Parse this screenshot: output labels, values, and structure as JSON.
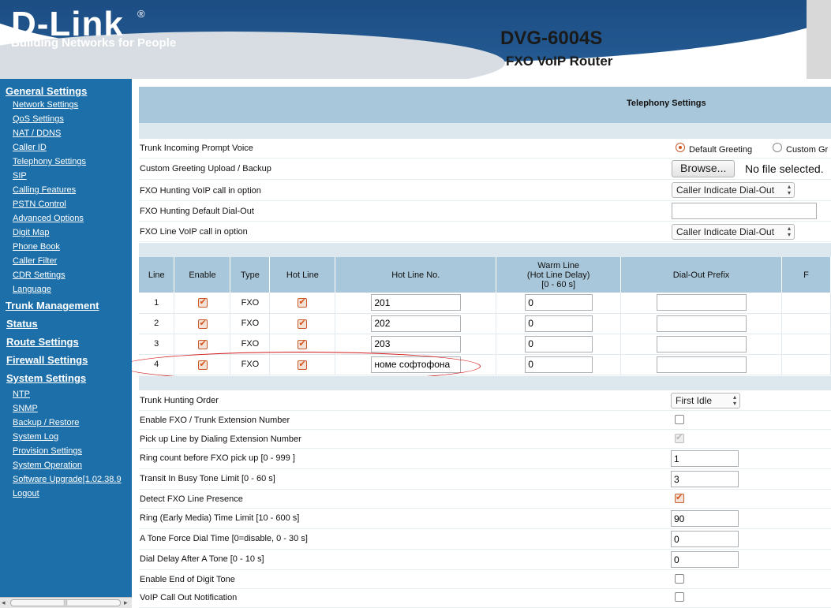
{
  "header": {
    "logo_text": "D-Link",
    "logo_reg": "®",
    "logo_tagline": "Building Networks for People",
    "model": "DVG-6004S",
    "model_sub": "FXO VoIP Router"
  },
  "sidebar": {
    "general": {
      "title": "General Settings",
      "items": [
        "Network Settings",
        "QoS Settings",
        "NAT / DDNS",
        "Caller ID",
        "Telephony Settings",
        "SIP",
        "Calling Features",
        "PSTN Control",
        "Advanced Options",
        "Digit Map",
        "Phone Book",
        "Caller Filter",
        "CDR Settings",
        "Language"
      ]
    },
    "trunk_management": "Trunk Management",
    "status": "Status",
    "route_settings": "Route Settings",
    "firewall_settings": "Firewall Settings",
    "system": {
      "title": "System Settings",
      "items": [
        "NTP",
        "SNMP",
        "Backup / Restore",
        "System Log",
        "Provision Settings",
        "System Operation",
        "Software Upgrade[1.02.38.9",
        "Logout"
      ]
    }
  },
  "page": {
    "title": "Telephony Settings"
  },
  "top_settings": {
    "prompt_voice_label": "Trunk Incoming Prompt Voice",
    "prompt_default": "Default Greeting",
    "prompt_custom": "Custom Gr",
    "greeting_label": "Custom Greeting Upload / Backup",
    "browse_label": "Browse...",
    "no_file": "No file selected.",
    "hunting_label": "FXO Hunting VoIP call in option",
    "hunting_value": "Caller Indicate Dial-Out",
    "hunting_default_label": "FXO Hunting Default Dial-Out",
    "hunting_default_value": "",
    "line_voip_label": "FXO Line VoIP call in option",
    "line_voip_value": "Caller Indicate Dial-Out"
  },
  "line_table": {
    "headers": {
      "line": "Line",
      "enable": "Enable",
      "type": "Type",
      "hot_line": "Hot Line",
      "hot_line_no": "Hot Line No.",
      "warm_line_1": "Warm Line",
      "warm_line_2": "(Hot Line Delay)",
      "warm_line_3": "[0 - 60 s]",
      "dial_out_prefix": "Dial-Out Prefix",
      "next": "F"
    },
    "rows": [
      {
        "line": "1",
        "type": "FXO",
        "enable": true,
        "hot_line": true,
        "hot_line_no": "201",
        "warm_line": "0",
        "prefix": ""
      },
      {
        "line": "2",
        "type": "FXO",
        "enable": true,
        "hot_line": true,
        "hot_line_no": "202",
        "warm_line": "0",
        "prefix": ""
      },
      {
        "line": "3",
        "type": "FXO",
        "enable": true,
        "hot_line": true,
        "hot_line_no": "203",
        "warm_line": "0",
        "prefix": ""
      },
      {
        "line": "4",
        "type": "FXO",
        "enable": true,
        "hot_line": true,
        "hot_line_no": "номе софтофона",
        "warm_line": "0",
        "prefix": ""
      }
    ]
  },
  "bottom_settings": {
    "trunk_hunting_label": "Trunk Hunting Order",
    "trunk_hunting_value": "First Idle",
    "enable_fxo_ext_label": "Enable FXO / Trunk Extension Number",
    "pickup_label": "Pick up Line by Dialing Extension Number",
    "ring_count_label": "Ring count before FXO pick up [0 - 999 ]",
    "ring_count_value": "1",
    "transit_busy_label": "Transit In Busy Tone Limit [0 - 60 s]",
    "transit_busy_value": "3",
    "detect_fxo_label": "Detect FXO Line Presence",
    "ring_limit_label": "Ring (Early Media) Time Limit [10 - 600 s]",
    "ring_limit_value": "90",
    "a_tone_force_label": "A Tone Force Dial Time [0=disable, 0 - 30 s]",
    "a_tone_force_value": "0",
    "dial_delay_label": "Dial Delay After A Tone [0 - 10 s]",
    "dial_delay_value": "0",
    "end_digit_label": "Enable End of Digit Tone",
    "voip_notify_label": "VoIP Call Out Notification"
  },
  "colors": {
    "sidebar_bg": "#1d6fa9",
    "header_blue": "#0f3a6e",
    "table_header": "#a9c7da",
    "band": "#dde8ee",
    "annotation_red": "#d41a1a",
    "check_orange": "#d4541c"
  }
}
